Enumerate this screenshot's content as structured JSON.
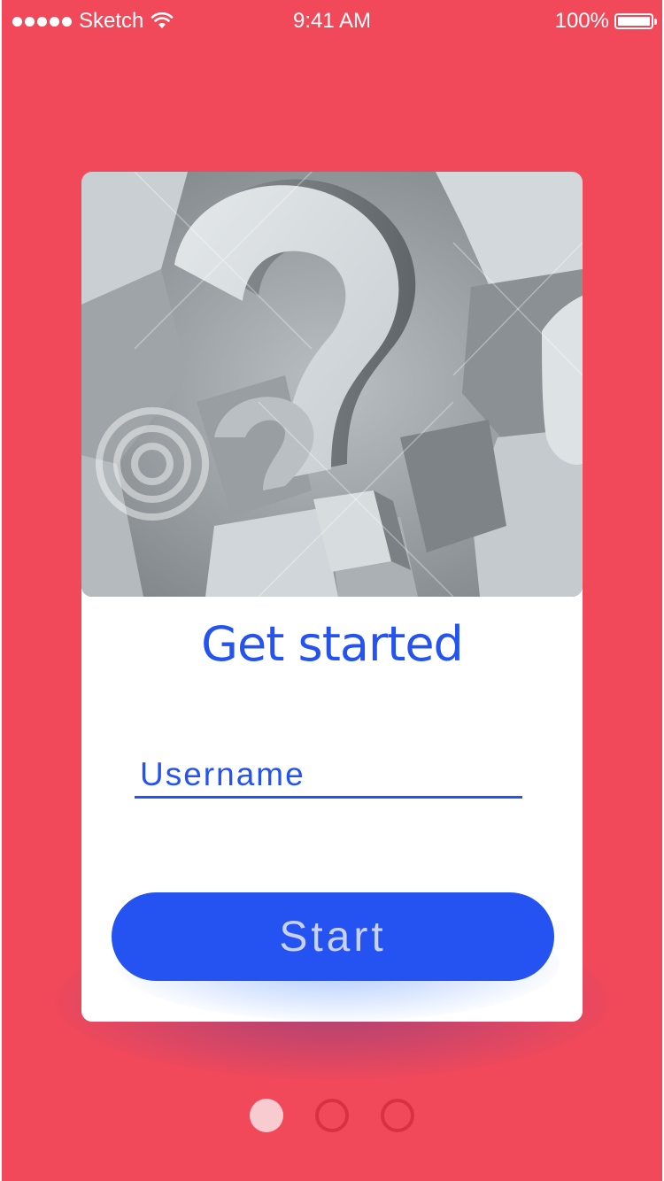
{
  "status_bar": {
    "carrier": "Sketch",
    "time": "9:41 AM",
    "battery": "100%",
    "icons": [
      "signal-icon",
      "wifi-icon",
      "battery-icon"
    ]
  },
  "card": {
    "image_alt": "question marks illustration",
    "title": "Get started",
    "username_placeholder": "Username",
    "start_label": "Start"
  },
  "pager": {
    "count": 3,
    "active_index": 0
  },
  "colors": {
    "background": "#f2495a",
    "accent": "#2453f2",
    "card": "#ffffff",
    "pager_active": "#f8cbd0",
    "pager_inactive": "#d93142"
  }
}
